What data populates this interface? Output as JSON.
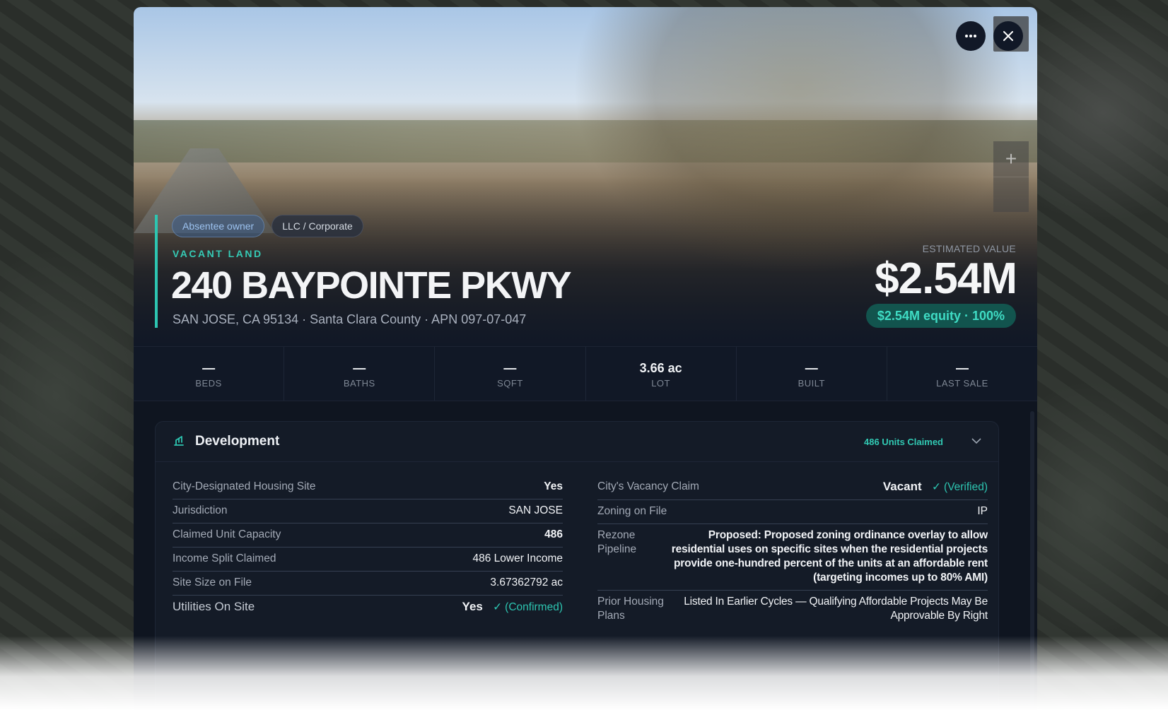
{
  "header": {
    "more_icon": "more-horizontal-icon",
    "close_icon": "close-icon",
    "zoom_in_icon": "plus-icon",
    "tags": [
      "Absentee owner",
      "LLC / Corporate"
    ],
    "property_type": "VACANT LAND",
    "address": "240 BAYPOINTE PKWY",
    "sub_address": "SAN JOSE, CA 95134 · Santa Clara County · APN 097-07-047",
    "estimated_value_label": "ESTIMATED VALUE",
    "estimated_value": "$2.54M",
    "equity": "$2.54M equity · 100%"
  },
  "stats": [
    {
      "value": "—",
      "label": "BEDS"
    },
    {
      "value": "—",
      "label": "BATHS"
    },
    {
      "value": "—",
      "label": "SQFT"
    },
    {
      "value": "3.66 ac",
      "label": "LOT"
    },
    {
      "value": "—",
      "label": "BUILT"
    },
    {
      "value": "—",
      "label": "LAST SALE"
    }
  ],
  "development": {
    "icon": "crane-icon",
    "title": "Development",
    "units_claimed": "486 Units Claimed",
    "chevron_icon": "chevron-down-icon",
    "left": [
      {
        "label": "City-Designated Housing Site",
        "value": "Yes"
      },
      {
        "label": "Jurisdiction",
        "value": "SAN JOSE"
      },
      {
        "label": "Claimed Unit Capacity",
        "value": "486"
      },
      {
        "label": "Income Split Claimed",
        "value": "486 Lower Income"
      },
      {
        "label": "Site Size on File",
        "value": "3.67362792 ac"
      },
      {
        "label": "Utilities On Site",
        "value": "Yes",
        "note": "(Confirmed)"
      }
    ],
    "right": [
      {
        "label": "City's Vacancy Claim",
        "value": "Vacant",
        "note": "(Verified)"
      },
      {
        "label": "Zoning on File",
        "value": "IP"
      },
      {
        "label": "Rezone Pipeline",
        "value": "Proposed: Proposed zoning ordinance overlay to allow residential uses on specific sites when the residential projects provide one-hundred percent of the units at an affordable rent (targeting incomes up to 80% AMI)"
      },
      {
        "label": "Prior Housing Plans",
        "value": "Listed In Earlier Cycles — Qualifying Affordable Projects May Be Approvable By Right"
      }
    ]
  }
}
